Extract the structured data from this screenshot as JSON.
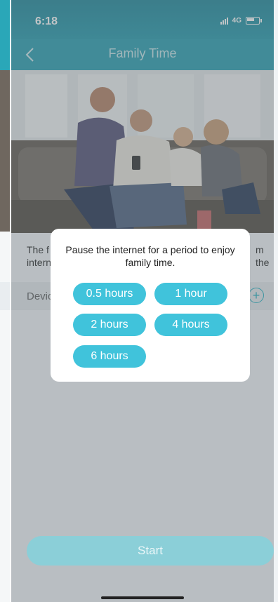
{
  "status": {
    "time": "6:18",
    "network": "4G"
  },
  "header": {
    "title": "Family Time"
  },
  "description": {
    "text_left": "The f",
    "text_left2": "intern",
    "text_right": "m the"
  },
  "devices": {
    "label": "Devic"
  },
  "modal": {
    "message": "Pause the internet for a period to enjoy family time.",
    "options": [
      {
        "label": "0.5 hours"
      },
      {
        "label": "1 hour"
      },
      {
        "label": "2 hours"
      },
      {
        "label": "4 hours"
      },
      {
        "label": "6 hours"
      }
    ]
  },
  "footer": {
    "start_label": "Start"
  },
  "colors": {
    "accent": "#40c3db",
    "header": "#33a4b5"
  }
}
